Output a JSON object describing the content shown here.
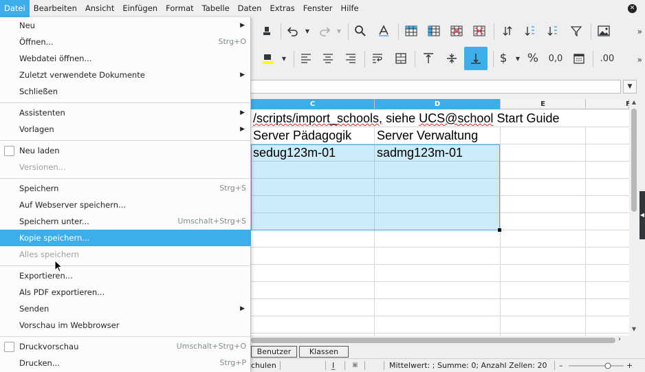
{
  "menubar": {
    "items": [
      {
        "label": "Datei",
        "active": true
      },
      {
        "label": "Bearbeiten"
      },
      {
        "label": "Ansicht"
      },
      {
        "label": "Einfügen"
      },
      {
        "label": "Format"
      },
      {
        "label": "Tabelle"
      },
      {
        "label": "Daten"
      },
      {
        "label": "Extras"
      },
      {
        "label": "Fenster"
      },
      {
        "label": "Hilfe"
      }
    ],
    "close_icon": "close-circle-icon"
  },
  "file_menu": {
    "items": [
      {
        "label": "Neu",
        "submenu": true
      },
      {
        "label": "Öffnen...",
        "shortcut": "Strg+O"
      },
      {
        "label": "Webdatei öffnen..."
      },
      {
        "label": "Zuletzt verwendete Dokumente",
        "submenu": true
      },
      {
        "label": "Schließen"
      },
      {
        "label": "Assistenten",
        "submenu": true
      },
      {
        "label": "Vorlagen",
        "submenu": true
      },
      {
        "label": "Neu laden",
        "checkbox": true
      },
      {
        "label": "Versionen...",
        "disabled": true
      },
      {
        "label": "Speichern",
        "shortcut": "Strg+S"
      },
      {
        "label": "Auf Webserver speichern..."
      },
      {
        "label": "Speichern unter...",
        "shortcut": "Umschalt+Strg+S"
      },
      {
        "label": "Kopie speichern...",
        "highlighted": true
      },
      {
        "label": "Alles speichern",
        "disabled": true
      },
      {
        "label": "Exportieren..."
      },
      {
        "label": "Als PDF exportieren..."
      },
      {
        "label": "Senden",
        "submenu": true
      },
      {
        "label": "Vorschau im Webbrowser"
      },
      {
        "label": "Druckvorschau",
        "shortcut": "Umschalt+Strg+O",
        "checkbox": true
      },
      {
        "label": "Drucken...",
        "shortcut": "Strg+P"
      }
    ]
  },
  "toolbar1": {
    "icons": [
      "paste-icon",
      "format-paintbrush-icon",
      "undo-icon",
      "undo-dropdown-icon",
      "redo-icon",
      "redo-dropdown-icon",
      "find-replace-icon",
      "spellcheck-icon",
      "row-icon",
      "column-icon",
      "insert-rows-icon",
      "insert-columns-icon",
      "sort-icon",
      "sort-ascending-icon",
      "sort-descending-icon",
      "autofilter-icon",
      "insert-image-icon",
      "overflow-icon"
    ]
  },
  "toolbar2": {
    "icons": [
      "font-color-icon",
      "align-left-icon",
      "align-center-icon",
      "align-right-icon",
      "wrap-text-icon",
      "merge-cells-icon",
      "align-top-icon",
      "align-middle-icon",
      "align-bottom-icon",
      "currency-icon",
      "percent-icon",
      "number-format-icon",
      "date-format-icon",
      "add-decimal-icon",
      "overflow-icon"
    ],
    "dollar": "$",
    "percent": "%",
    "number": "0,0",
    "decimal": ".00",
    "font_color_bar": "#ffff00"
  },
  "sheet": {
    "columns": [
      {
        "label": "C",
        "selected": true
      },
      {
        "label": "D",
        "selected": true
      },
      {
        "label": "E",
        "selected": false
      },
      {
        "label": "F",
        "selected": false
      }
    ],
    "rows": [
      {
        "c": "/scripts/import_schools, siehe UCS@school Start Guide",
        "d": ""
      },
      {
        "c": "Server Pädagogik",
        "d": "Server Verwaltung"
      },
      {
        "c": "sedug123m-01",
        "d": "sadmg123m-01"
      }
    ]
  },
  "sheet_tabs": [
    "Benutzer",
    "Klassen"
  ],
  "statusbar": {
    "sheet_fragment": "chulen",
    "insert_mode": "I̲",
    "summary": "Mittelwert: ; Summe: 0; Anzahl Zellen: 20",
    "zoom_minus": "–",
    "zoom_plus": "+"
  }
}
